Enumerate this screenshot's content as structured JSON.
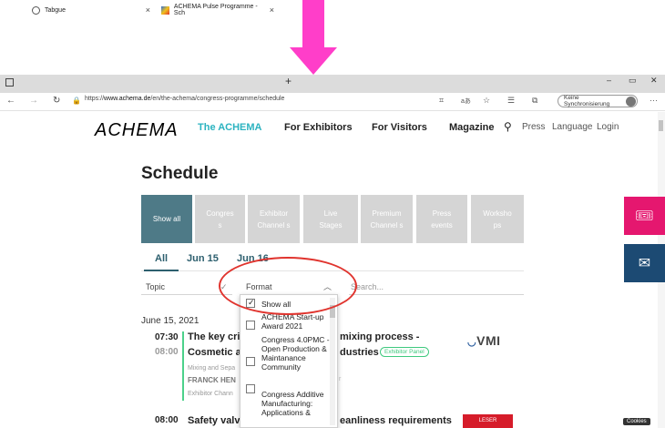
{
  "browser": {
    "tabs": [
      {
        "label": "Tabgue"
      },
      {
        "label": "ACHEMA Pulse Programme - Sch"
      }
    ],
    "url_prefix": "https://",
    "url_host": "www.achema.de",
    "url_path": "/en/the-achema/congress-programme/schedule",
    "sync_label": "Keine Synchronisierung"
  },
  "site": {
    "logo": "ACHEMA",
    "nav": [
      "The ACHEMA",
      "For Exhibitors",
      "For Visitors",
      "Magazine"
    ],
    "utility": [
      "Press",
      "Language",
      "Login"
    ],
    "accent_color": "#2bb3c0"
  },
  "page": {
    "title": "Schedule",
    "tiles": [
      {
        "label": "Show all",
        "active": true
      },
      {
        "label": "Congres s",
        "active": false
      },
      {
        "label": "Exhibitor Channel s",
        "active": false
      },
      {
        "label": "Live Stages",
        "active": false
      },
      {
        "label": "Premium Channel s",
        "active": false
      },
      {
        "label": "Press events",
        "active": false
      },
      {
        "label": "Worksho ps",
        "active": false
      }
    ],
    "day_tabs": [
      "All",
      "Jun 15",
      "Jun 16"
    ],
    "filters": {
      "topic": "Topic",
      "format": "Format",
      "search_placeholder": "Search..."
    },
    "format_options": [
      {
        "label": "Show all",
        "checked": true
      },
      {
        "label": "ACHEMA Start-up Award 2021",
        "checked": false
      },
      {
        "label": "Congress 4.0PMC - Open Production & Maintanance Community",
        "checked": false
      },
      {
        "label": "Congress Additive Manufacturing: Applications &",
        "checked": false
      }
    ],
    "date": "June 15, 2021",
    "sessions": [
      {
        "start": "07:30",
        "end": "08:00",
        "title_line1": "The key crit",
        "title_line1b": "mixing process -",
        "title_line2": "Cosmetic ar",
        "title_line2b": "dustries",
        "badge": "Exhibitor Panel",
        "meta": "Mixing and Sepa",
        "speaker": "FRANCK HEN",
        "channel": "Exhibitor Chann",
        "logo": "VMI"
      },
      {
        "start": "08:00",
        "title_line1": "Safety valv",
        "title_line1b": "eanliness requirements",
        "logo": "LESER"
      }
    ],
    "cookies": "Cookies"
  }
}
